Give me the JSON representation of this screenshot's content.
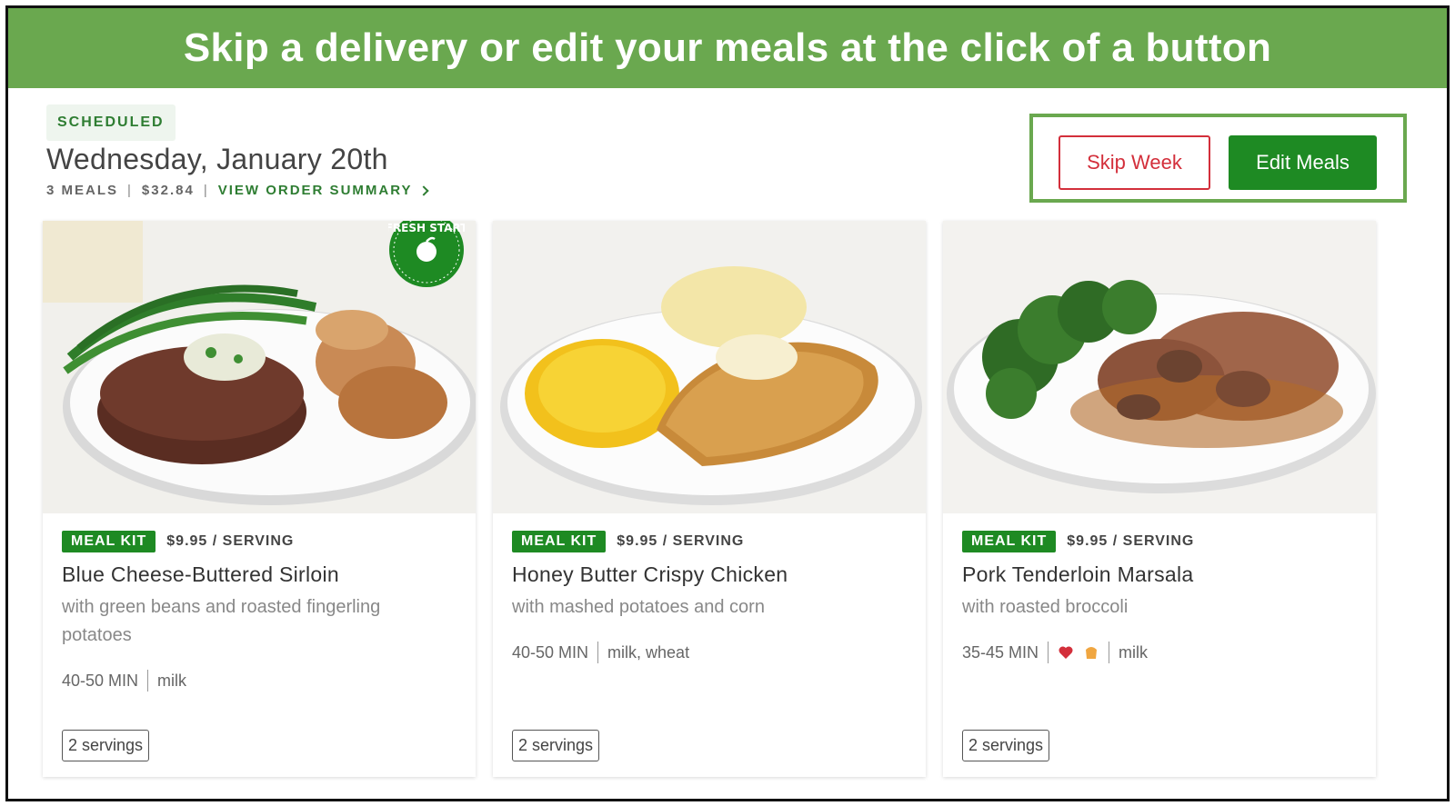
{
  "banner": {
    "title": "Skip a delivery or edit your meals at the click of a button"
  },
  "order": {
    "status": "SCHEDULED",
    "date": "Wednesday, January 20th",
    "meals_count": "3 MEALS",
    "total": "$32.84",
    "summary_link": "VIEW ORDER SUMMARY"
  },
  "actions": {
    "skip_label": "Skip Week",
    "edit_label": "Edit Meals"
  },
  "cards": [
    {
      "badge": "MEAL KIT",
      "price": "$9.95 / SERVING",
      "title": "Blue Cheese-Buttered Sirloin",
      "subtitle": "with green beans and roasted fingerling potatoes",
      "time": "40-50 MIN",
      "allergens": "milk",
      "servings": "2 servings",
      "ribbon": "FRESH START"
    },
    {
      "badge": "MEAL KIT",
      "price": "$9.95 / SERVING",
      "title": "Honey Butter Crispy Chicken",
      "subtitle": "with mashed potatoes and corn",
      "time": "40-50 MIN",
      "allergens": "milk, wheat",
      "servings": "2 servings"
    },
    {
      "badge": "MEAL KIT",
      "price": "$9.95 / SERVING",
      "title": "Pork Tenderloin Marsala",
      "subtitle": "with roasted broccoli",
      "time": "35-45 MIN",
      "allergens": "milk",
      "icons": [
        "heart-icon",
        "carb-icon"
      ],
      "servings": "2 servings"
    }
  ],
  "colors": {
    "banner": "#6aa84f",
    "brand_green": "#1e8a23",
    "skip_red": "#d32f3b"
  }
}
